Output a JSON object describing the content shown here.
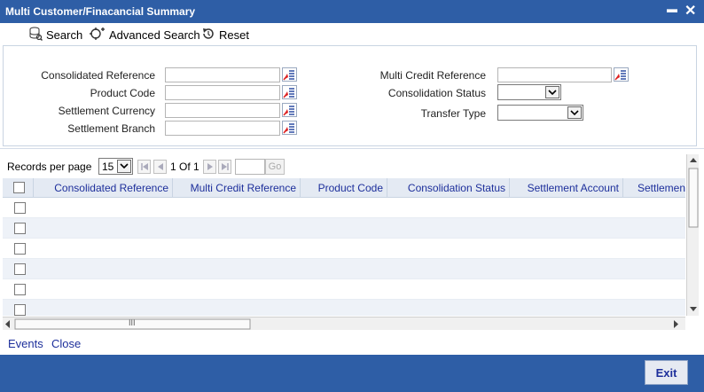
{
  "window": {
    "title": "Multi Customer/Finacancial Summary",
    "minimize_glyph": "▬",
    "close_glyph": "✕"
  },
  "toolbar": {
    "search_label": "Search",
    "advanced_search_label": "Advanced Search",
    "reset_label": "Reset"
  },
  "search_form": {
    "consolidated_reference_label": "Consolidated Reference",
    "product_code_label": "Product Code",
    "settlement_currency_label": "Settlement Currency",
    "settlement_branch_label": "Settlement Branch",
    "multi_credit_reference_label": "Multi Credit Reference",
    "consolidation_status_label": "Consolidation Status",
    "transfer_type_label": "Transfer Type",
    "consolidated_reference_value": "",
    "product_code_value": "",
    "settlement_currency_value": "",
    "settlement_branch_value": "",
    "multi_credit_reference_value": "",
    "consolidation_status_value": "",
    "transfer_type_value": ""
  },
  "pager": {
    "records_per_page_label": "Records per page",
    "records_per_page_value": "15",
    "page_status": "1 Of 1",
    "goto_value": "",
    "go_label": "Go"
  },
  "grid": {
    "columns": [
      "Consolidated Reference",
      "Multi Credit Reference",
      "Product Code",
      "Consolidation Status",
      "Settlement Account",
      "Settlemen"
    ],
    "rows": [
      {
        "cells": [
          "",
          "",
          "",
          "",
          "",
          ""
        ]
      },
      {
        "cells": [
          "",
          "",
          "",
          "",
          "",
          ""
        ]
      },
      {
        "cells": [
          "",
          "",
          "",
          "",
          "",
          ""
        ]
      },
      {
        "cells": [
          "",
          "",
          "",
          "",
          "",
          ""
        ]
      },
      {
        "cells": [
          "",
          "",
          "",
          "",
          "",
          ""
        ]
      },
      {
        "cells": [
          "",
          "",
          "",
          "",
          "",
          ""
        ]
      }
    ],
    "scroll_grip": "III"
  },
  "footer": {
    "events_label": "Events",
    "close_label": "Close",
    "exit_label": "Exit"
  },
  "colors": {
    "title_bar": "#2e5ea6",
    "link_text": "#1d2f9b",
    "grid_header_bg": "#e4eaf3",
    "row_alt_bg": "#eef2f8"
  }
}
